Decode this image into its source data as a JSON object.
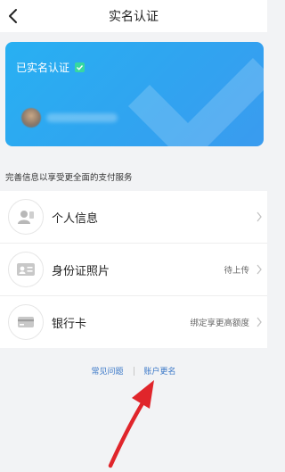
{
  "header": {
    "title": "实名认证",
    "back_icon": "back-arrow-icon"
  },
  "card": {
    "status": "已实名认证",
    "status_icon": "check-icon",
    "bg_color": "#2fa8f0"
  },
  "section_title": "完善信息以享受更全面的支付服务",
  "list": {
    "items": [
      {
        "label": "个人信息",
        "value": "",
        "icon": "person-id-icon"
      },
      {
        "label": "身份证照片",
        "value": "待上传",
        "icon": "id-card-icon"
      },
      {
        "label": "银行卡",
        "value": "绑定享更高额度",
        "icon": "bank-card-icon"
      }
    ]
  },
  "footer": {
    "faq": "常见问题",
    "rename": "账户更名",
    "link_color": "#3b78c8"
  },
  "annotation": {
    "color": "#e0252b"
  }
}
